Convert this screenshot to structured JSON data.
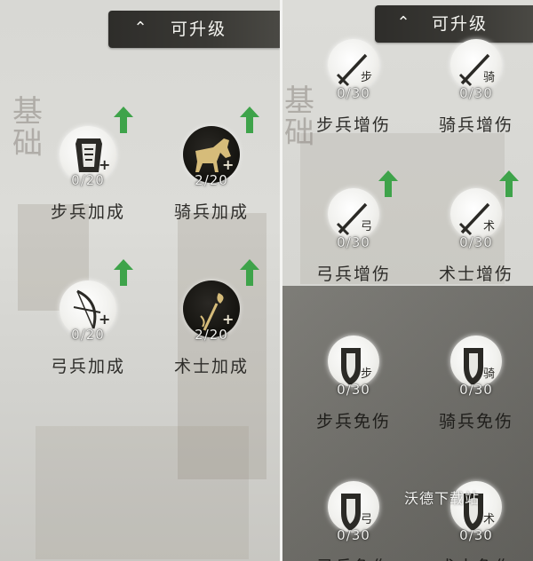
{
  "header": {
    "title": "可升级"
  },
  "section": {
    "label": "基础"
  },
  "left_skills": [
    {
      "name": "步兵加成",
      "count": "0/20",
      "unlocked": false,
      "upgradable": true
    },
    {
      "name": "骑兵加成",
      "count": "2/20",
      "unlocked": true,
      "upgradable": true
    },
    {
      "name": "弓兵加成",
      "count": "0/20",
      "unlocked": false,
      "upgradable": true
    },
    {
      "name": "术士加成",
      "count": "2/20",
      "unlocked": true,
      "upgradable": true
    }
  ],
  "right_skills": [
    {
      "name": "步兵增伤",
      "count": "0/30",
      "tag": "步",
      "upgradable": false
    },
    {
      "name": "骑兵增伤",
      "count": "0/30",
      "tag": "骑",
      "upgradable": false
    },
    {
      "name": "弓兵增伤",
      "count": "0/30",
      "tag": "弓",
      "upgradable": true
    },
    {
      "name": "术士增伤",
      "count": "0/30",
      "tag": "术",
      "upgradable": true
    },
    {
      "name": "步兵免伤",
      "count": "0/30",
      "tag": "步",
      "upgradable": false
    },
    {
      "name": "骑兵免伤",
      "count": "0/30",
      "tag": "骑",
      "upgradable": false
    },
    {
      "name": "弓兵免伤",
      "count": "0/30",
      "tag": "弓",
      "upgradable": false
    },
    {
      "name": "术士免伤",
      "count": "0/30",
      "tag": "术",
      "upgradable": false
    }
  ],
  "watermark": "沃德下载站",
  "colors": {
    "upgrade_arrow": "#3ea34a",
    "header_bg": "#2e2d2a",
    "dark_orb": "#14130f",
    "light_orb": "#f1f1ee"
  }
}
